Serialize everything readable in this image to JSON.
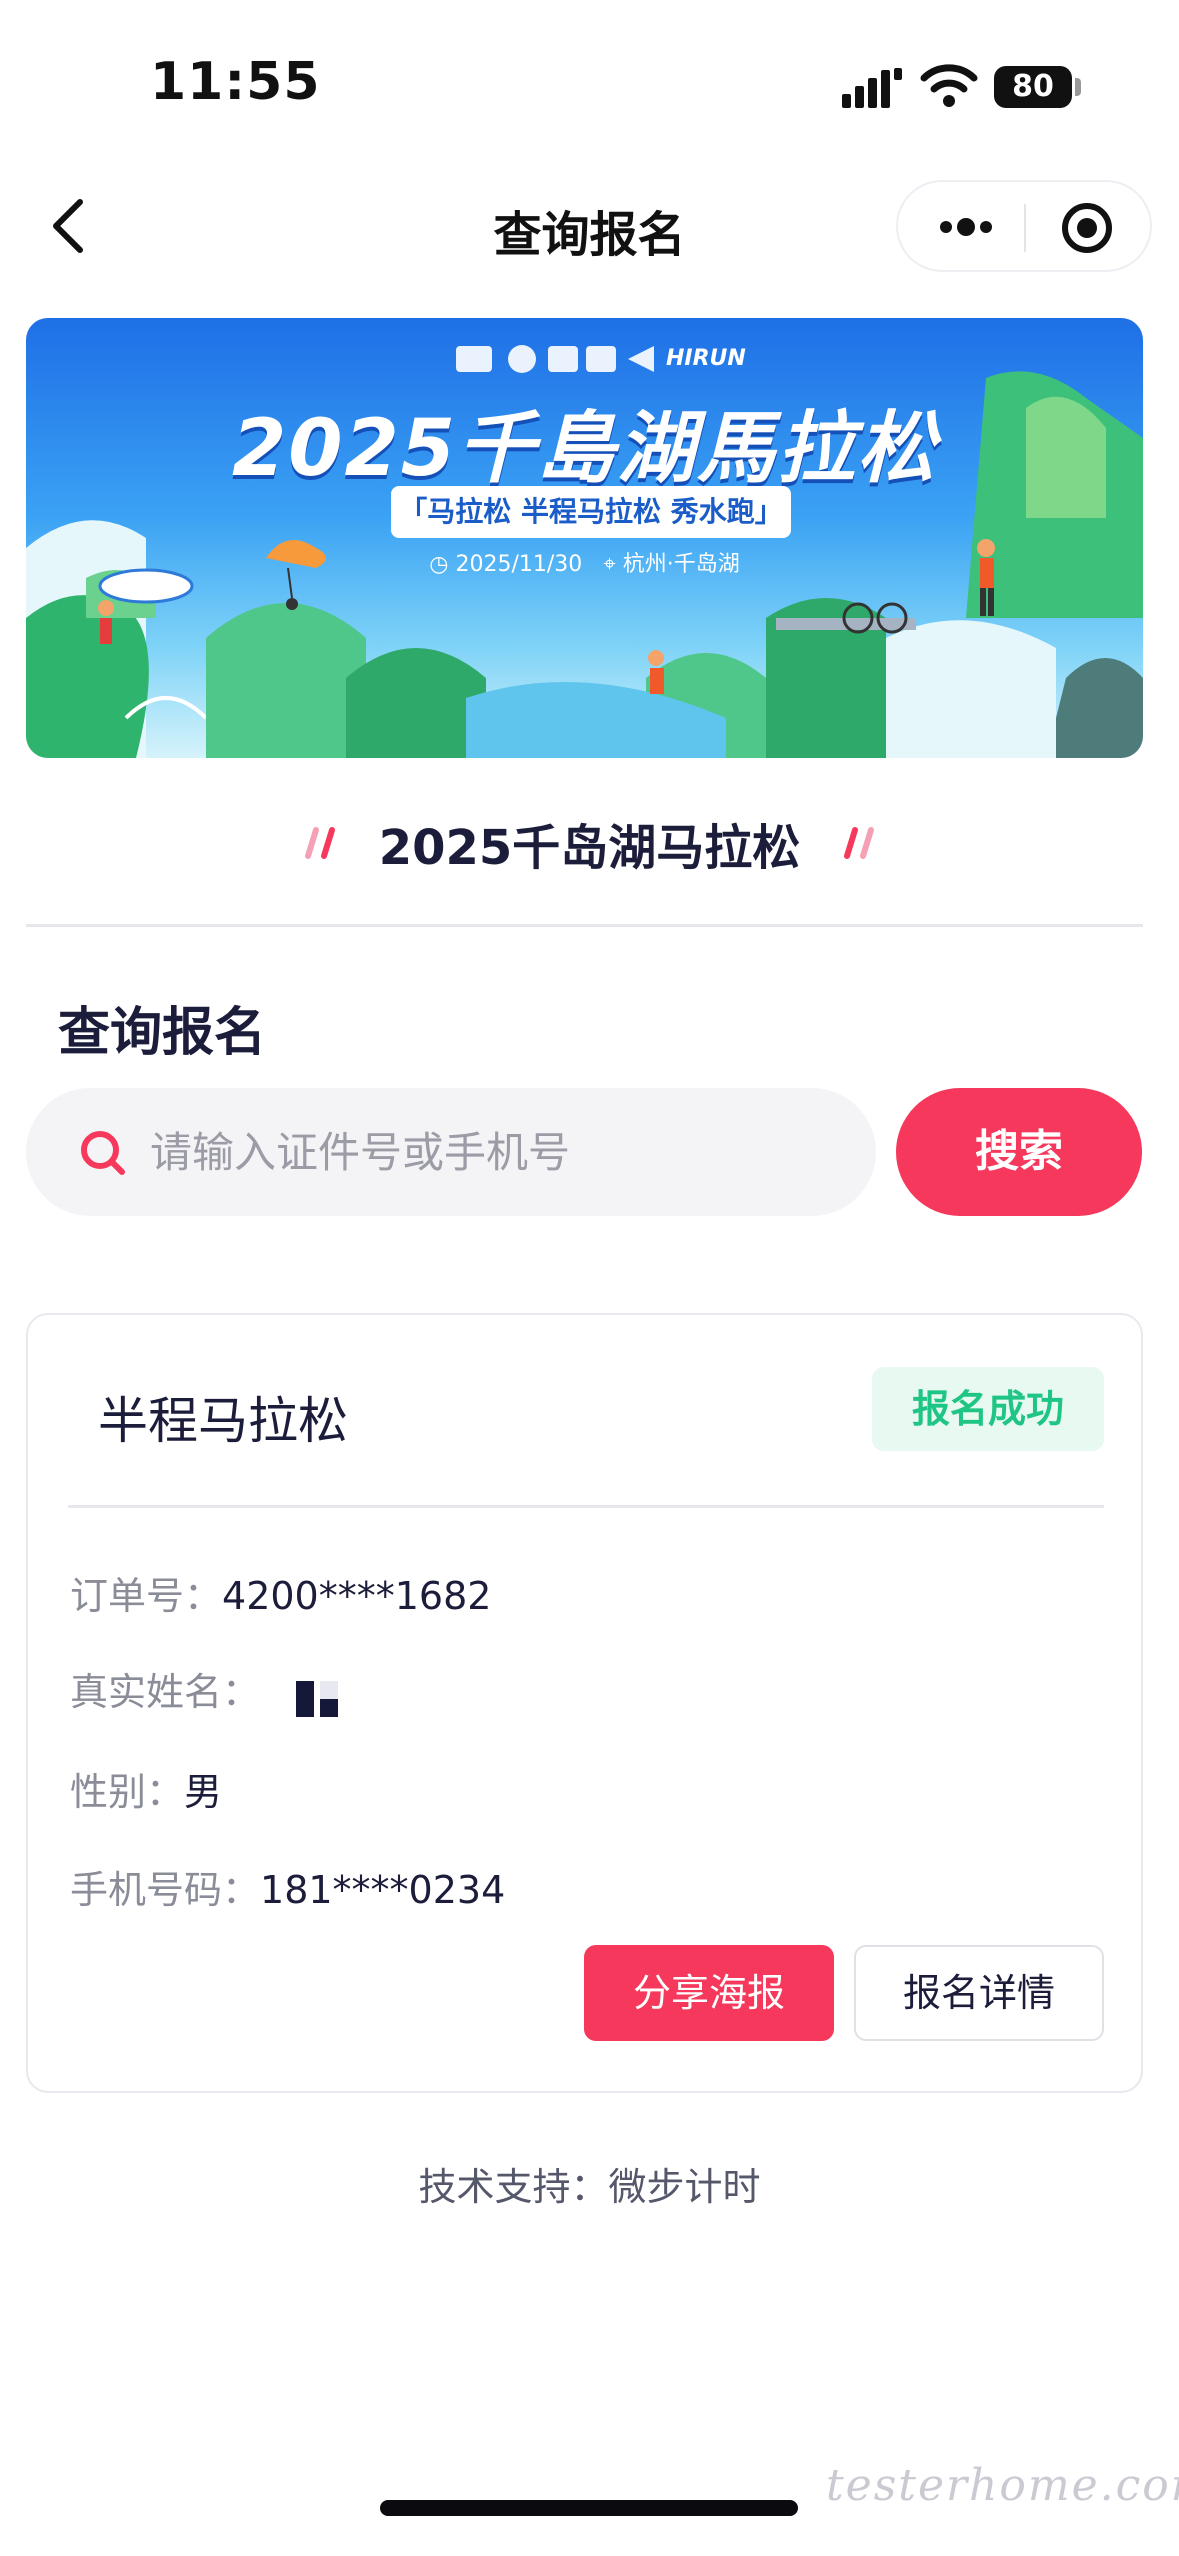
{
  "status_bar": {
    "time": "11:55",
    "battery": "80"
  },
  "nav": {
    "title": "查询报名"
  },
  "banner": {
    "title": "2025千島湖馬拉松",
    "subtitle": "「马拉松 半程马拉松 秀水跑」",
    "date": "2025/11/30",
    "location": "杭州·千岛湖",
    "sponsor": "HIRUN"
  },
  "event": {
    "name": "2025千岛湖马拉松"
  },
  "query": {
    "section_title": "查询报名",
    "placeholder": "请输入证件号或手机号",
    "search_label": "搜索"
  },
  "result": {
    "race": "半程马拉松",
    "status": "报名成功",
    "order_label": "订单号：",
    "order_value": "4200****1682",
    "name_label": "真实姓名：",
    "gender_label": "性别：",
    "gender_value": "男",
    "phone_label": "手机号码：",
    "phone_value": "181****0234",
    "share_label": "分享海报",
    "detail_label": "报名详情"
  },
  "footer": {
    "text": "技术支持：微步计时"
  },
  "watermark": "testerhome.com",
  "colors": {
    "accent": "#f5385b",
    "success": "#1fc584",
    "success_bg": "#e8f9f1",
    "text": "#1b1d3a"
  }
}
